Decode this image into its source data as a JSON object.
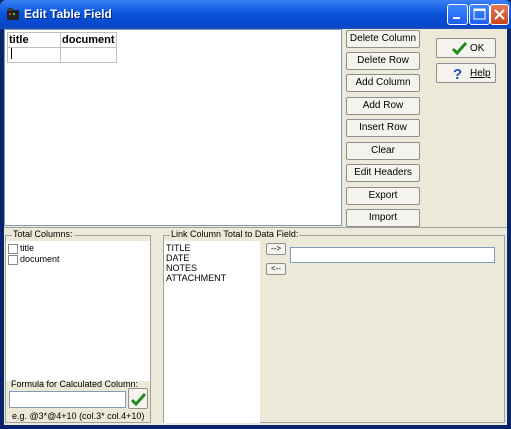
{
  "window": {
    "title": "Edit Table Field",
    "controls": [
      "minimize",
      "maximize",
      "close"
    ]
  },
  "table": {
    "headers": [
      "title",
      "document"
    ],
    "rows": [
      [
        "",
        ""
      ]
    ]
  },
  "actions": {
    "delete_column": "Delete Column",
    "delete_row": "Delete Row",
    "add_column": "Add Column",
    "add_row": "Add Row",
    "insert_row": "Insert Row",
    "clear": "Clear",
    "edit_headers": "Edit Headers",
    "export": "Export",
    "import": "Import"
  },
  "dialog": {
    "ok_label": "OK",
    "help_label": "Help",
    "ok_icon": "green-check-icon",
    "help_icon": "question-mark-icon"
  },
  "total_columns": {
    "label": "Total Columns:",
    "items": [
      {
        "label": "title",
        "checked": false
      },
      {
        "label": "document",
        "checked": false
      }
    ]
  },
  "formula": {
    "label": "Formula for Calculated Column:",
    "value": "",
    "example": "e.g. @3*@4+10  (col.3* col.4+10)"
  },
  "link": {
    "label": "Link Column Total to Data Field:",
    "fields": [
      "TITLE",
      "DATE",
      "NOTES",
      "ATTACHMENT"
    ],
    "link_button": "-->",
    "unlink_button": "<--",
    "linked_value": ""
  },
  "colors": {
    "titlebar": "#0855dd",
    "client": "#ece9d8",
    "check": "#1f8a1f"
  }
}
